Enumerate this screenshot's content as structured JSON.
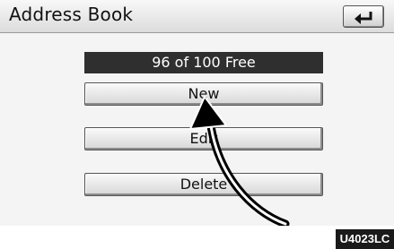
{
  "header": {
    "title": "Address Book"
  },
  "status": {
    "text": "96 of 100 Free"
  },
  "menu": {
    "new_label": "New",
    "edit_label": "Edit",
    "delete_label": "Delete"
  },
  "figure_code": "U4023LC",
  "icons": {
    "back": "back-arrow-icon",
    "pointer": "curved-arrow-icon"
  }
}
